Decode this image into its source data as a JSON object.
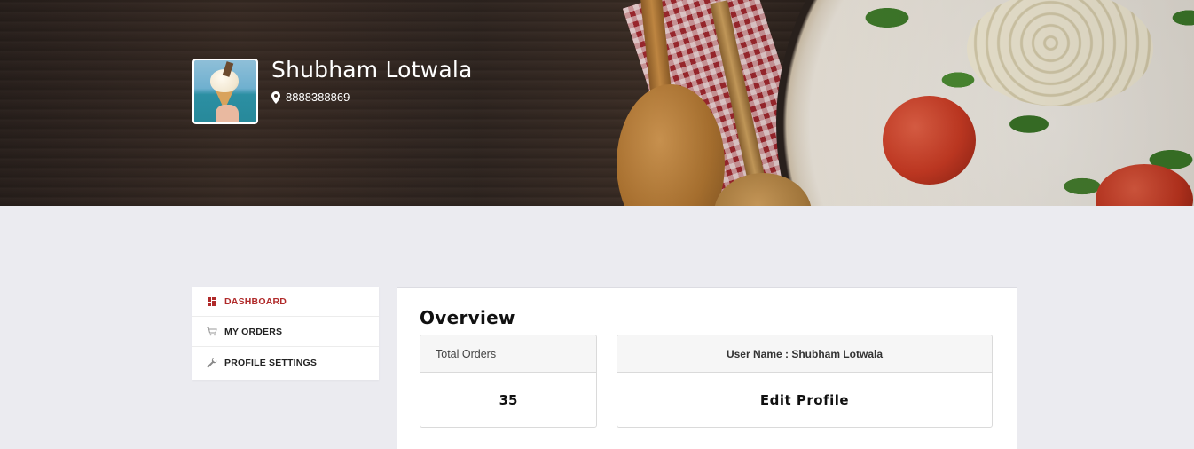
{
  "header": {
    "user_name": "Shubham Lotwala",
    "location": "8888388869",
    "location_icon": "map-pin-icon",
    "avatar_alt": "avatar"
  },
  "sidebar": {
    "items": [
      {
        "label": "DASHBOARD",
        "icon": "dashboard-icon",
        "active": true
      },
      {
        "label": "MY ORDERS",
        "icon": "cart-icon",
        "active": false
      },
      {
        "label": "PROFILE SETTINGS",
        "icon": "wrench-icon",
        "active": false
      }
    ]
  },
  "main": {
    "title": "Overview",
    "total_orders": {
      "label": "Total Orders",
      "value": "35"
    },
    "profile_card": {
      "label": "User Name : Shubham Lotwala",
      "action": "Edit Profile"
    }
  },
  "colors": {
    "accent": "#b02a2a",
    "page_bg": "#ebebf0",
    "card_header_bg": "#f6f6f6"
  }
}
